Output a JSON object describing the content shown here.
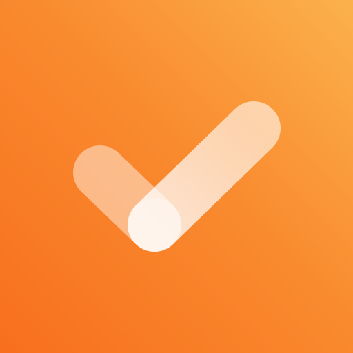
{
  "app_icon": {
    "icon": "checkmark-icon",
    "colors": {
      "gradient_start": "#f86f1d",
      "gradient_mid": "#f98b2f",
      "gradient_end": "#fbb14c",
      "check_stroke": "#ffffff"
    }
  }
}
